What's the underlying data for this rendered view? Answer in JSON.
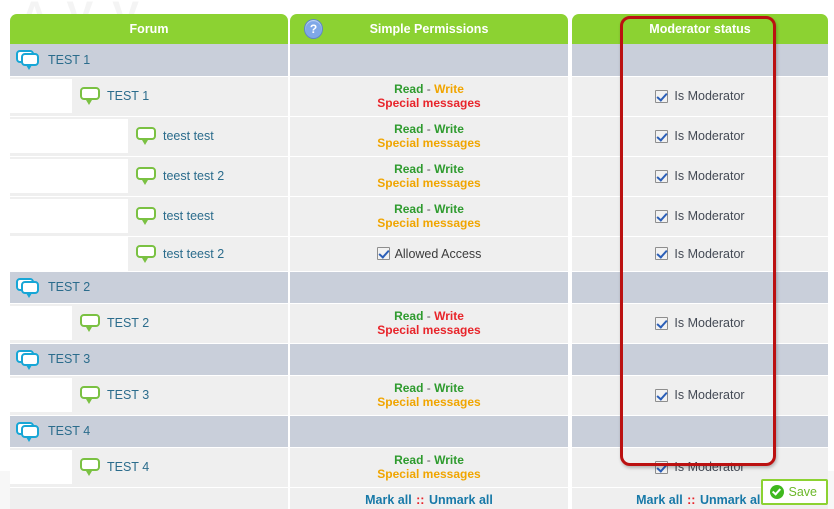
{
  "page": {
    "watermark_text": "A V V"
  },
  "header": {
    "forum_label": "Forum",
    "permissions_label": "Simple Permissions",
    "moderator_label": "Moderator status",
    "help_icon_glyph": "?",
    "help_icon_name": "question-mark-icon",
    "header_bg": "#8cd232"
  },
  "labels": {
    "read": "Read",
    "write": "Write",
    "dash": "-",
    "special_messages": "Special messages",
    "allowed_access": "Allowed Access",
    "is_moderator": "Is Moderator",
    "mark_all": "Mark all",
    "separator": "::",
    "unmark_all": "Unmark all"
  },
  "colors": {
    "green": "#2e9b2e",
    "orange": "#f0a500",
    "red": "#e8242a",
    "link_blue": "#1779a8",
    "category_row": "#c9cfda",
    "forum_row": "#efefef",
    "annotation": "#bb1111"
  },
  "rows": [
    {
      "type": "category",
      "indent": 0,
      "name": "TEST 1",
      "icon": "forum-category-icon"
    },
    {
      "type": "forum",
      "indent": 1,
      "name": "TEST 1",
      "icon": "forum-bubble-icon",
      "permissions": {
        "mode": "links",
        "read_color": "green",
        "write_color": "orange",
        "special_color": "red"
      },
      "moderator": {
        "checked": true
      }
    },
    {
      "type": "forum",
      "indent": 2,
      "name": "teest test",
      "icon": "forum-bubble-icon",
      "permissions": {
        "mode": "links",
        "read_color": "green",
        "write_color": "green",
        "special_color": "orange"
      },
      "moderator": {
        "checked": true
      }
    },
    {
      "type": "forum",
      "indent": 2,
      "name": "teest test 2",
      "icon": "forum-bubble-icon",
      "permissions": {
        "mode": "links",
        "read_color": "green",
        "write_color": "green",
        "special_color": "orange"
      },
      "moderator": {
        "checked": true
      }
    },
    {
      "type": "forum",
      "indent": 2,
      "name": "test teest",
      "icon": "forum-bubble-icon",
      "permissions": {
        "mode": "links",
        "read_color": "green",
        "write_color": "green",
        "special_color": "orange"
      },
      "moderator": {
        "checked": true
      }
    },
    {
      "type": "forum",
      "indent": 2,
      "name": "test teest 2",
      "icon": "forum-bubble-icon",
      "permissions": {
        "mode": "checkbox",
        "checked": true
      },
      "moderator": {
        "checked": true
      }
    },
    {
      "type": "category",
      "indent": 0,
      "name": "TEST 2",
      "icon": "forum-category-icon"
    },
    {
      "type": "forum",
      "indent": 1,
      "name": "TEST 2",
      "icon": "forum-bubble-icon",
      "permissions": {
        "mode": "links",
        "read_color": "green",
        "write_color": "red",
        "special_color": "red"
      },
      "moderator": {
        "checked": true
      }
    },
    {
      "type": "category",
      "indent": 0,
      "name": "TEST 3",
      "icon": "forum-category-icon"
    },
    {
      "type": "forum",
      "indent": 1,
      "name": "TEST 3",
      "icon": "forum-bubble-icon",
      "permissions": {
        "mode": "links",
        "read_color": "green",
        "write_color": "green",
        "special_color": "orange"
      },
      "moderator": {
        "checked": true
      }
    },
    {
      "type": "category",
      "indent": 0,
      "name": "TEST 4",
      "icon": "forum-category-icon"
    },
    {
      "type": "forum",
      "indent": 1,
      "name": "TEST 4",
      "icon": "forum-bubble-icon",
      "permissions": {
        "mode": "links",
        "read_color": "green",
        "write_color": "green",
        "special_color": "orange"
      },
      "moderator": {
        "checked": true
      }
    }
  ],
  "footer": {
    "save_label": "Save",
    "save_icon": "check-circle-icon"
  }
}
